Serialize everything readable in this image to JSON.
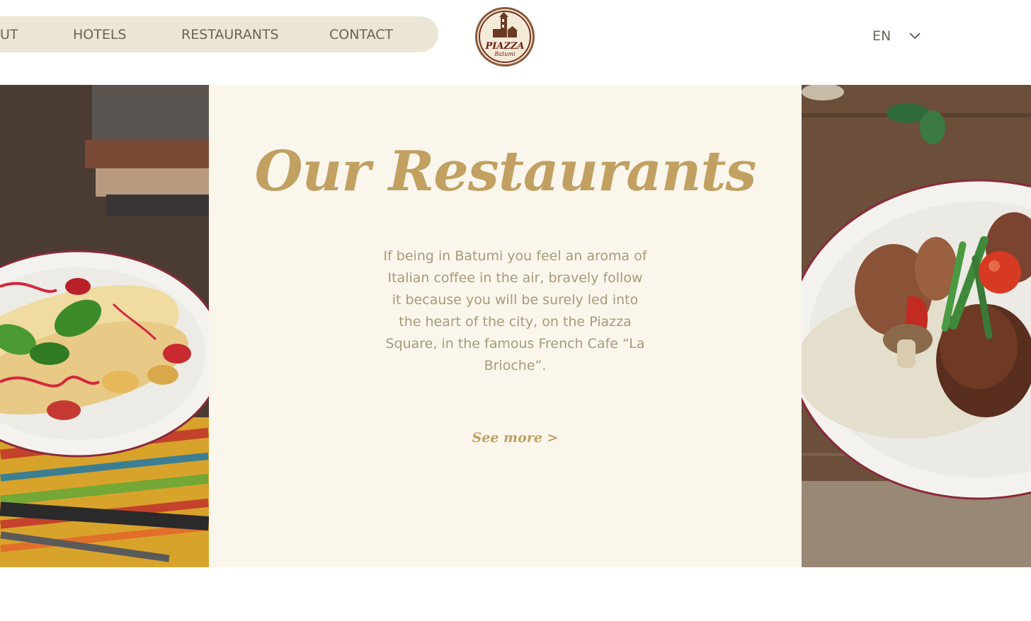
{
  "nav": {
    "items": [
      {
        "label": "UT"
      },
      {
        "label": "HOTELS"
      },
      {
        "label": "RESTAURANTS"
      },
      {
        "label": "CONTACT"
      }
    ]
  },
  "logo": {
    "name": "PIAZZA",
    "city": "Batumi"
  },
  "language": {
    "current": "EN"
  },
  "hero": {
    "title": "Our Restaurants",
    "description": "If being in Batumi you feel an aroma of Italian coffee in the air, bravely follow it because you will be surely led into the heart of the city, on the Piazza Square, in the famous French Cafe “La Brioche”.",
    "cta": "See more >"
  },
  "colors": {
    "accent": "#c1a061",
    "panel_bg": "#faf6ec",
    "nav_bg": "#ebe6d6",
    "text": "#6a6458"
  }
}
